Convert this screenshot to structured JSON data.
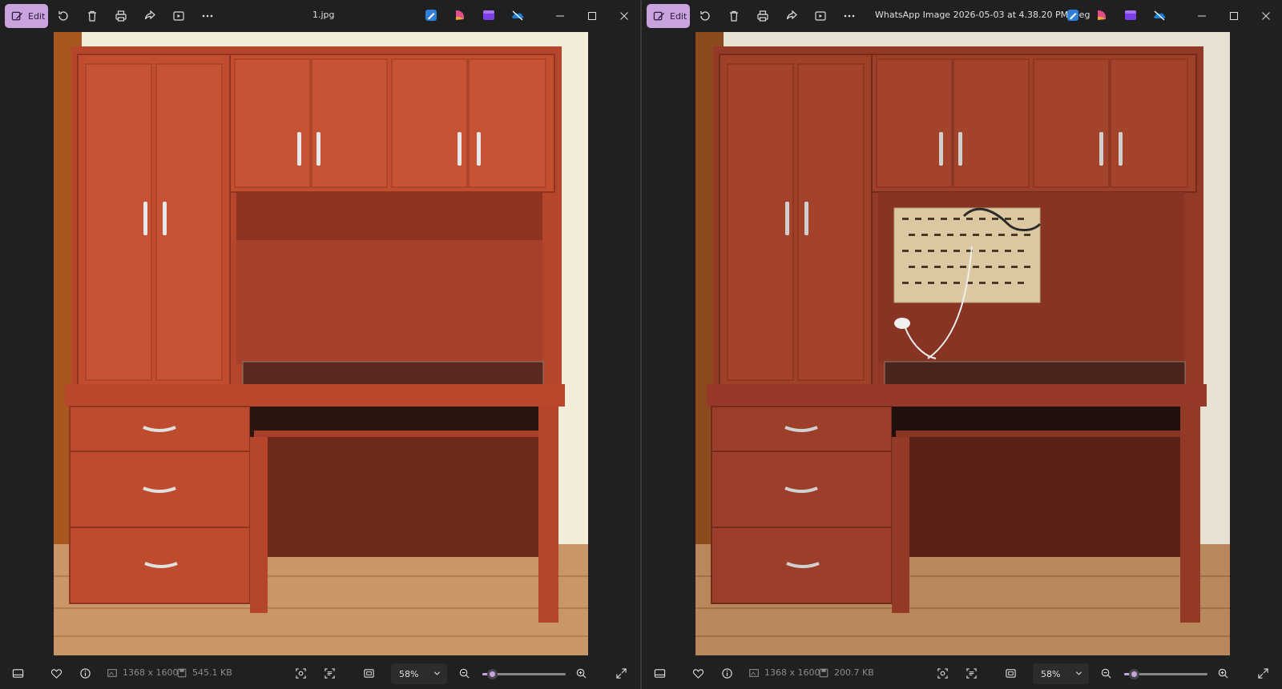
{
  "colors": {
    "accent": "#c9a2e0",
    "background": "#202020"
  },
  "windows": [
    {
      "edit_label": "Edit",
      "file_name": "1.jpg",
      "dimensions": "1368 x 1600",
      "file_size": "545.1 KB",
      "zoom": "58%",
      "zoom_fraction": 0.12,
      "image": {
        "variant": "plain-wall",
        "has_pegboard": false,
        "brightness": "warm"
      }
    },
    {
      "edit_label": "Edit",
      "file_name": "WhatsApp Image 2026-05-03 at 4.38.20 PM.jpeg",
      "dimensions": "1368 x 1600",
      "file_size": "200.7 KB",
      "zoom": "58%",
      "zoom_fraction": 0.12,
      "image": {
        "variant": "pegboard-wall",
        "has_pegboard": true,
        "brightness": "muted"
      }
    }
  ],
  "toolbar_icons": [
    "edit-icon",
    "rotate-icon",
    "delete-icon",
    "print-icon",
    "share-icon",
    "slideshow-icon",
    "more-icon"
  ],
  "app_icons": [
    "photo-editor-icon",
    "designer-icon",
    "clipchamp-icon",
    "onedrive-icon"
  ],
  "bottom_icons": [
    "filmstrip-icon",
    "favorite-icon",
    "info-icon",
    "image-size-icon",
    "file-size-icon",
    "visual-search-icon",
    "text-scan-icon",
    "fit-icon",
    "zoom-out-icon",
    "zoom-in-icon",
    "fullscreen-icon"
  ]
}
